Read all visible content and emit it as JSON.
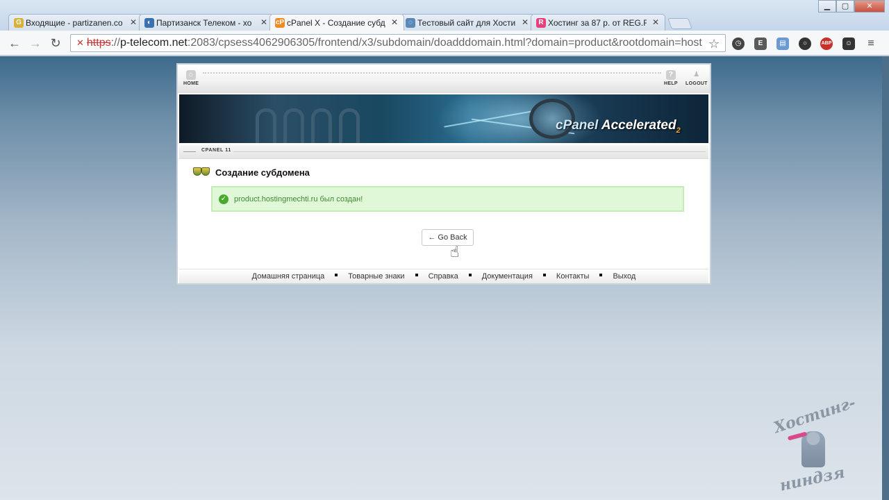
{
  "browser": {
    "tabs": [
      {
        "label": "Входящие - partizanen.co",
        "favicon": "gmail-icon",
        "color": "#d8b13a",
        "active": false
      },
      {
        "label": "Партизанск Телеком - хо",
        "favicon": "globe-icon",
        "color": "#3a6fb0",
        "active": false
      },
      {
        "label": "cPanel X - Создание субд",
        "favicon": "cpanel-icon",
        "color": "#f08a24",
        "active": true
      },
      {
        "label": "Тестовый сайт для Хости",
        "favicon": "loading-icon",
        "color": "#5a88b8",
        "active": false
      },
      {
        "label": "Хостинг за 87 р. от REG.R",
        "favicon": "reg-ru-icon",
        "color": "#e8407a",
        "active": false
      }
    ],
    "url": {
      "scheme": "https",
      "host": "p-telecom.net",
      "path": ":2083/cpsess4062906305/frontend/x3/subdomain/doadddomain.html?domain=product&rootdomain=host"
    }
  },
  "cpanel": {
    "nav": {
      "home": "HOME",
      "help": "HELP",
      "logout": "LOGOUT"
    },
    "logo": {
      "brand": "cPanel",
      "product": "Accelerated",
      "version": "2"
    },
    "breadcrumb": "CPANEL 11",
    "page_title": "Создание субдомена",
    "success_message": "product.hostingmechti.ru был создан!",
    "go_back": "← Go Back",
    "footer_links": [
      "Домашняя страница",
      "Товарные знаки",
      "Справка",
      "Документация",
      "Контакты",
      "Выход"
    ]
  },
  "watermark": {
    "line1": "Хостинг-",
    "line2": "ниндзя"
  }
}
